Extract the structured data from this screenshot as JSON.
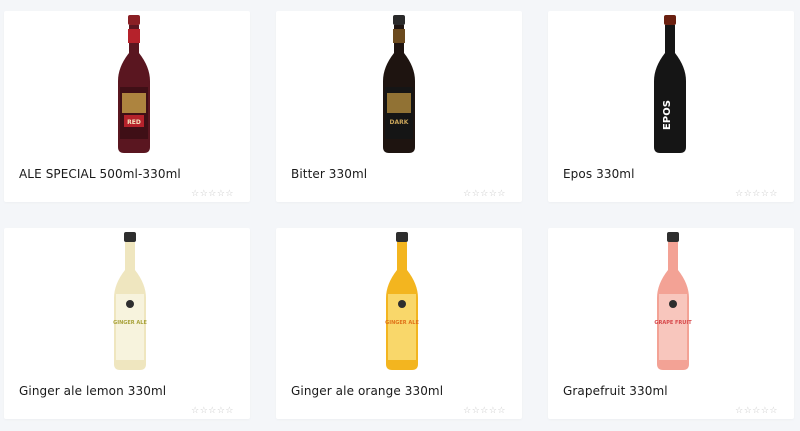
{
  "products": [
    {
      "name": "ALE SPECIAL 500ml-330ml",
      "label": "RED",
      "brand": "CORFU BEER",
      "body_color": "#5a1620",
      "cap_color": "#8a1f24",
      "label_color": "#b5222b",
      "icon": "beer-bottle-icon",
      "rating_display": "☆☆☆☆☆"
    },
    {
      "name": "Bitter 330ml",
      "label": "DARK",
      "brand": "CORFU BEER",
      "body_color": "#1e1410",
      "cap_color": "#2a2a2a",
      "label_color": "#1c1c1c",
      "icon": "beer-bottle-icon",
      "rating_display": "☆☆☆☆☆"
    },
    {
      "name": "Epos 330ml",
      "label": "EPOS",
      "brand": "",
      "body_color": "#151515",
      "cap_color": "#6a2010",
      "label_color": "#151515",
      "icon": "beer-bottle-icon",
      "rating_display": "☆☆☆☆☆"
    },
    {
      "name": "Ginger ale lemon 330ml",
      "label": "GINGER ALE",
      "brand": "",
      "body_color": "#efe6bf",
      "cap_color": "#2e2e2e",
      "label_color": "#f7f3dd",
      "icon": "soda-bottle-icon",
      "rating_display": "☆☆☆☆☆"
    },
    {
      "name": "Ginger ale orange 330ml",
      "label": "GINGER ALE",
      "brand": "",
      "body_color": "#f3b51f",
      "cap_color": "#2e2e2e",
      "label_color": "#f9d76a",
      "icon": "soda-bottle-icon",
      "rating_display": "☆☆☆☆☆"
    },
    {
      "name": "Grapefruit 330ml",
      "label": "GRAPE FRUIT",
      "brand": "",
      "body_color": "#f3a295",
      "cap_color": "#2e2e2e",
      "label_color": "#f8c6bd",
      "icon": "soda-bottle-icon",
      "rating_display": "☆☆☆☆☆"
    }
  ]
}
